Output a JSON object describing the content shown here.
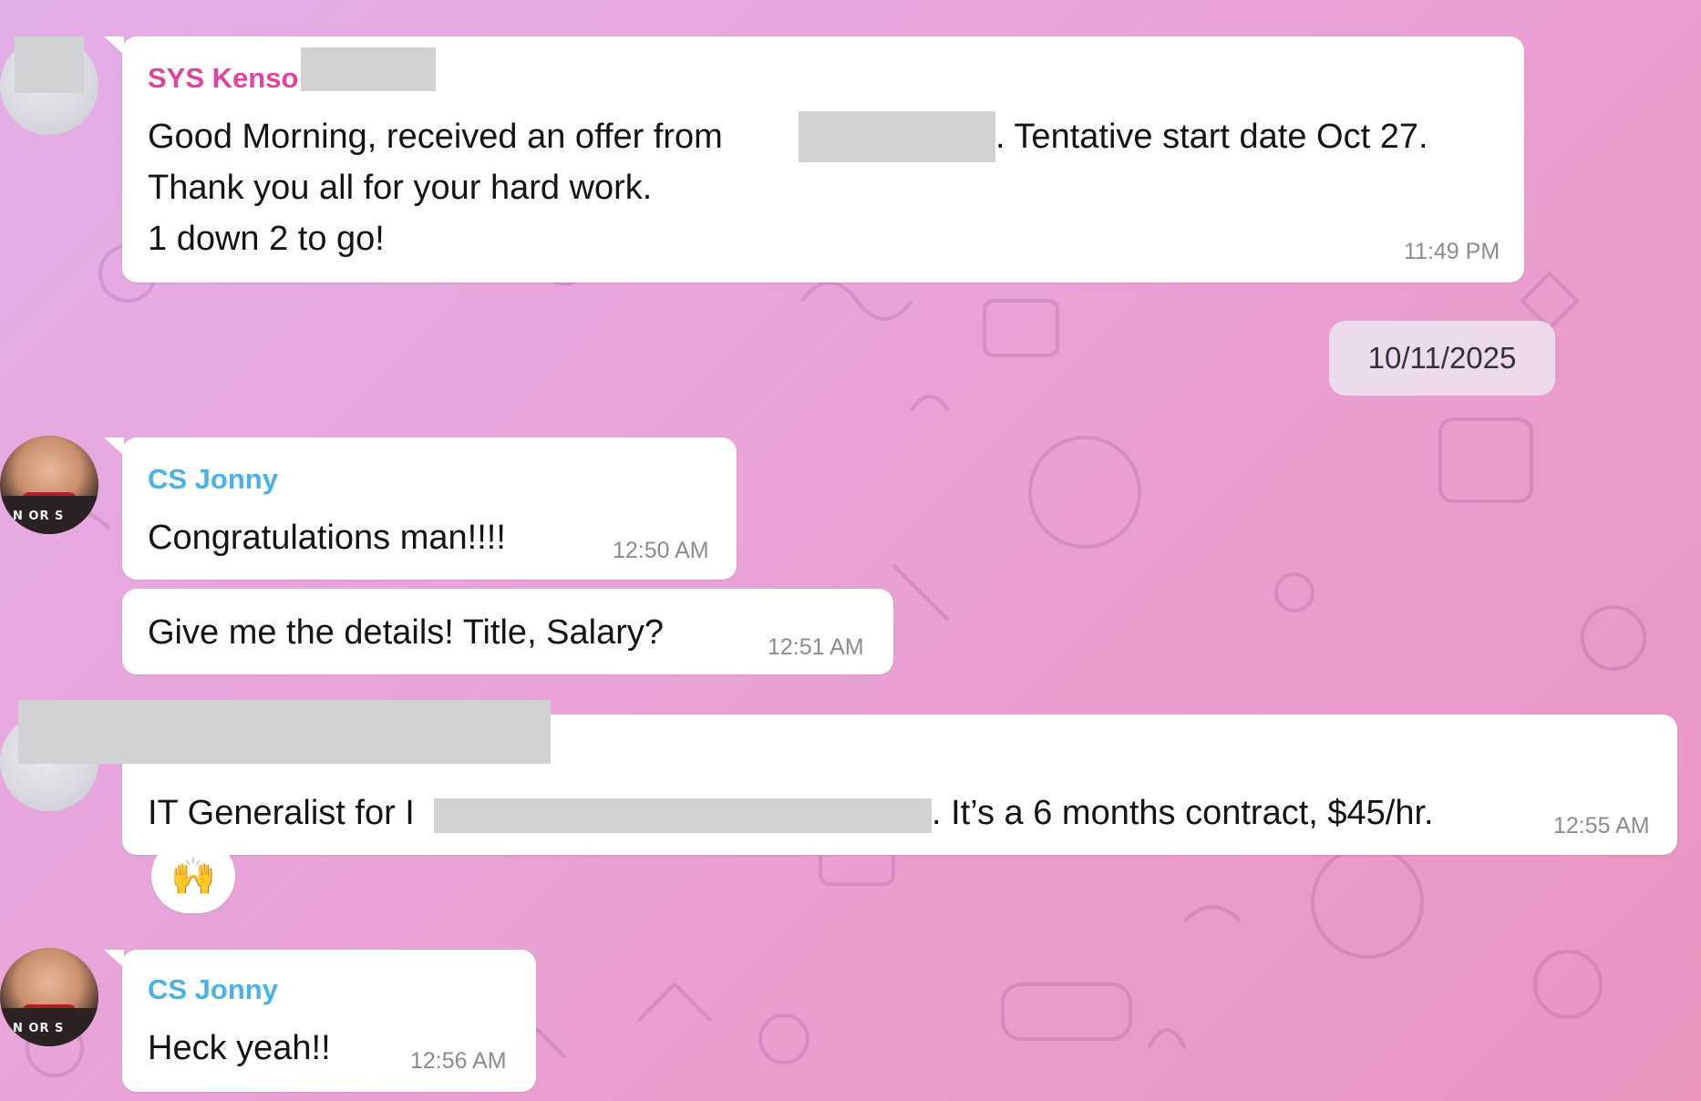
{
  "messages": [
    {
      "sender": "SYS Kenso",
      "lines": [
        "Good Morning, received an offer from",
        ". Tentative start date Oct 27.",
        "Thank you all for your hard work.",
        "1 down 2 to go!"
      ],
      "time": "11:49 PM"
    },
    {
      "sender": "CS Jonny",
      "text": "Congratulations man!!!!",
      "time": "12:50 AM"
    },
    {
      "text": "Give me the details! Title, Salary?",
      "time": "12:51 AM"
    },
    {
      "text_before_redaction": "IT Generalist for I",
      "text_after_redaction": ". It’s a 6 months contract, $45/hr.",
      "time": "12:55 AM",
      "reaction": {
        "icon": "raising-hands-icon",
        "glyph": "🙌"
      }
    },
    {
      "sender": "CS Jonny",
      "text": "Heck yeah!!",
      "time": "12:56 AM"
    }
  ],
  "date_separator": "10/11/2025",
  "avatar_text": "N OR S",
  "colors": {
    "sys_sender": "#e0449f",
    "cs_sender": "#49b3e6",
    "bubble": "#ffffff",
    "redaction": "#d2d2d5"
  }
}
